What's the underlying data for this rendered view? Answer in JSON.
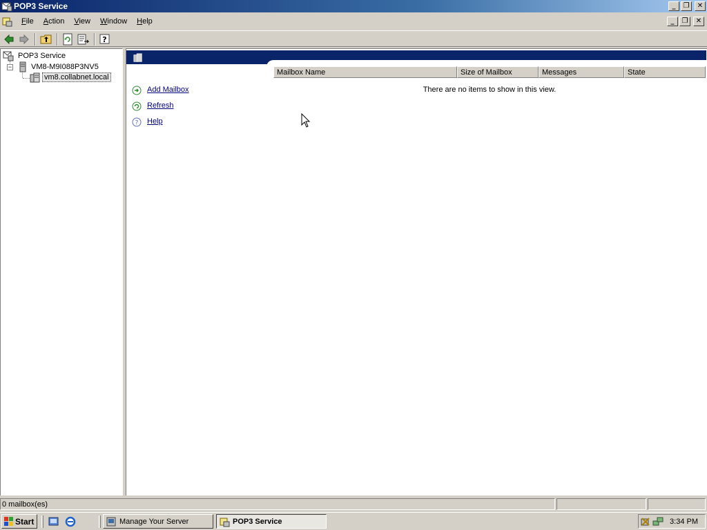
{
  "window": {
    "title": "POP3 Service",
    "minimize_glyph": "_",
    "restore_glyph": "❐",
    "close_glyph": "✕"
  },
  "menu": {
    "items": [
      {
        "name": "menu-file",
        "accel": "F",
        "rest": "ile"
      },
      {
        "name": "menu-action",
        "accel": "A",
        "rest": "ction"
      },
      {
        "name": "menu-view",
        "accel": "V",
        "rest": "iew"
      },
      {
        "name": "menu-window",
        "accel": "W",
        "rest": "indow"
      },
      {
        "name": "menu-help",
        "accel": "H",
        "rest": "elp"
      }
    ]
  },
  "toolbar": {
    "icons": [
      "back-arrow-icon",
      "forward-arrow-icon",
      "up-folder-icon",
      "refresh-icon",
      "export-list-icon",
      "help-icon"
    ]
  },
  "tree": {
    "root": "POP3 Service",
    "server": "VM8-M9I088P3NV5",
    "domain": "vm8.collabnet.local",
    "expander_glyph": "−"
  },
  "tasks": [
    {
      "label": "Add Mailbox",
      "icon": "add-mailbox-icon"
    },
    {
      "label": "Refresh",
      "icon": "refresh-icon"
    },
    {
      "label": "Help",
      "icon": "help-icon"
    }
  ],
  "list": {
    "columns": [
      "Mailbox Name",
      "Size of Mailbox",
      "Messages",
      "State"
    ],
    "empty_message": "There are no items to show in this view."
  },
  "statusbar": {
    "text": "0 mailbox(es)"
  },
  "taskbar": {
    "start_label": "Start",
    "buttons": [
      {
        "label": "Manage Your Server",
        "active": false
      },
      {
        "label": "POP3 Service",
        "active": true
      }
    ],
    "clock": "3:34 PM"
  },
  "colors": {
    "title_gradient_start": "#0a246a",
    "title_gradient_end": "#a6caf0",
    "banner": "#0a246a",
    "link": "#000080",
    "chrome": "#d4d0c8"
  }
}
